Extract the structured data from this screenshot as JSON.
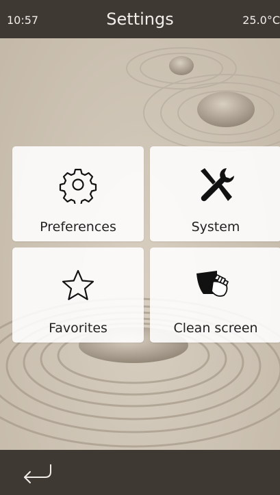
{
  "status_bar": {
    "time": "10:57",
    "title": "Settings",
    "temperature": "25.0°C"
  },
  "tiles": [
    {
      "label": "Preferences",
      "icon": "gear-icon"
    },
    {
      "label": "System",
      "icon": "wrench-screwdriver-icon"
    },
    {
      "label": "Favorites",
      "icon": "star-icon"
    },
    {
      "label": "Clean screen",
      "icon": "hand-wiping-screen-icon"
    }
  ],
  "bottom_bar": {
    "back_icon": "return-arrow-icon"
  },
  "colors": {
    "bar_background": "#3f3934",
    "tile_background": "#ffffff",
    "text_dark": "#222222",
    "text_light": "#f2efea"
  }
}
